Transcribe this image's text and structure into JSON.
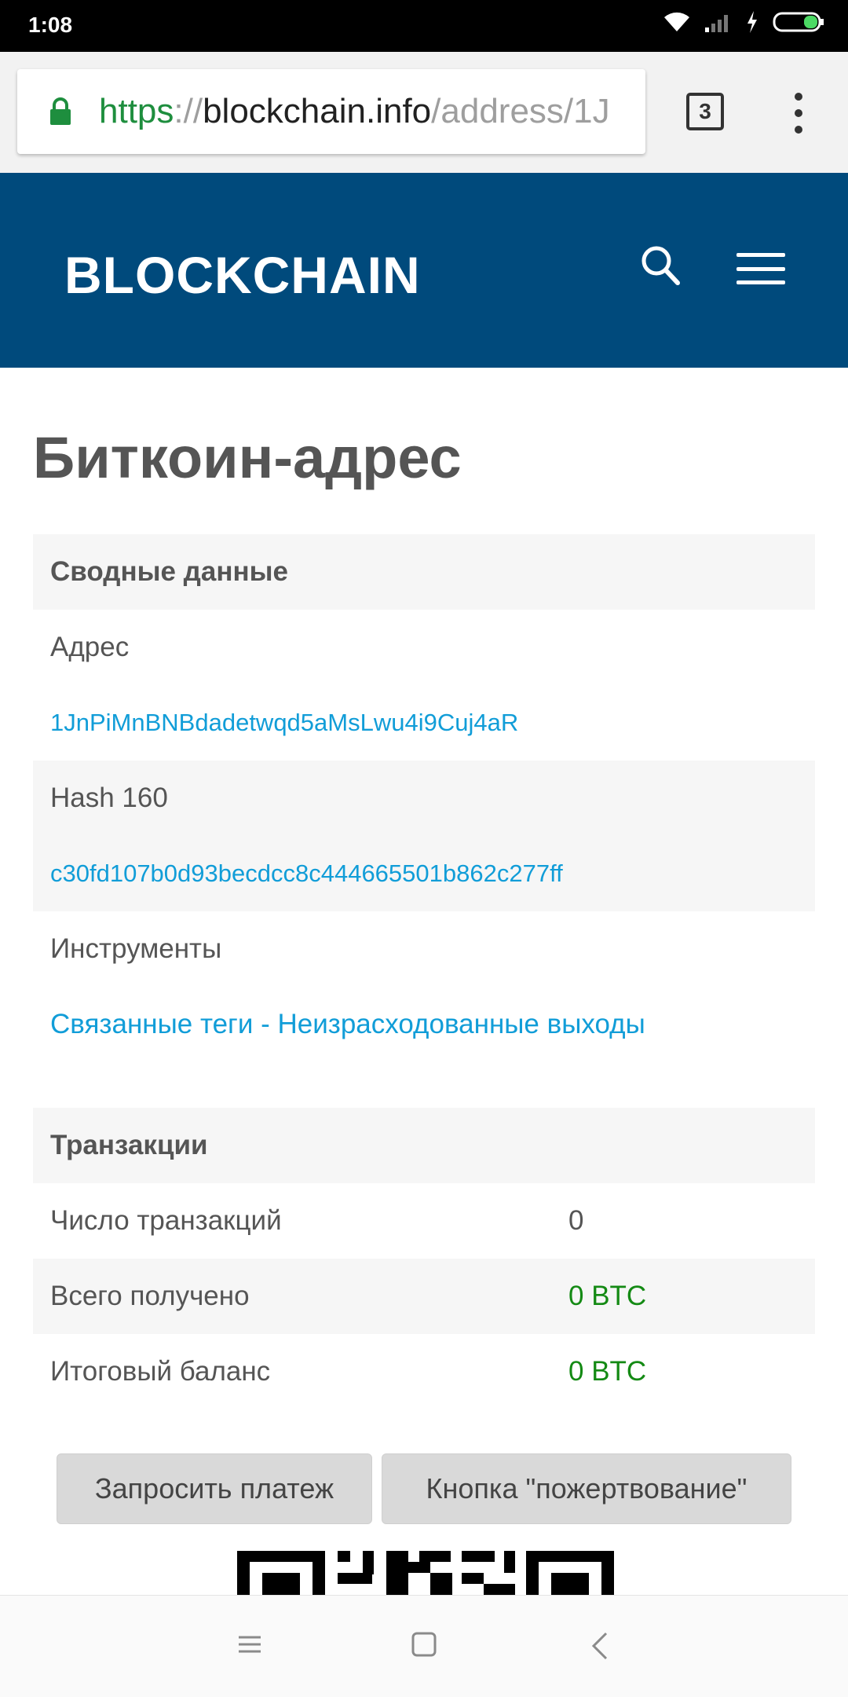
{
  "status_bar": {
    "time": "1:08"
  },
  "browser": {
    "url_scheme": "https",
    "url_separator": "://",
    "url_host": "blockchain.info",
    "url_path": "/address/1J",
    "tab_count": "3"
  },
  "header": {
    "logo": "BLOCKCHAIN"
  },
  "page": {
    "title": "Биткоин-адрес"
  },
  "summary": {
    "heading": "Сводные данные",
    "address_label": "Адрес",
    "address_value": "1JnPiMnBNBdadetwqd5aMsLwu4i9Cuj4aR",
    "hash_label": "Hash 160",
    "hash_value": "c30fd107b0d93becdcc8c444665501b862c277ff",
    "tools_label": "Инструменты",
    "tools_link_1": "Связанные теги",
    "tools_separator": " - ",
    "tools_link_2": "Неизрасходованные выходы"
  },
  "transactions": {
    "heading": "Транзакции",
    "rows": [
      {
        "label": "Число транзакций",
        "value": "0"
      },
      {
        "label": "Всего получено",
        "value": "0 BTC"
      },
      {
        "label": "Итоговый баланс",
        "value": "0 BTC"
      }
    ]
  },
  "actions": {
    "request_label": "Запросить платеж",
    "donate_label": "Кнопка \"пожертвование\""
  },
  "colors": {
    "header_bg": "#004a7c",
    "link": "#119dd8",
    "btc_green": "#148a14",
    "secure_green": "#1e8e3e"
  },
  "icons": {
    "lock": "lock-icon",
    "search": "search-icon",
    "menu": "hamburger-icon",
    "overflow": "more-vert-icon"
  }
}
